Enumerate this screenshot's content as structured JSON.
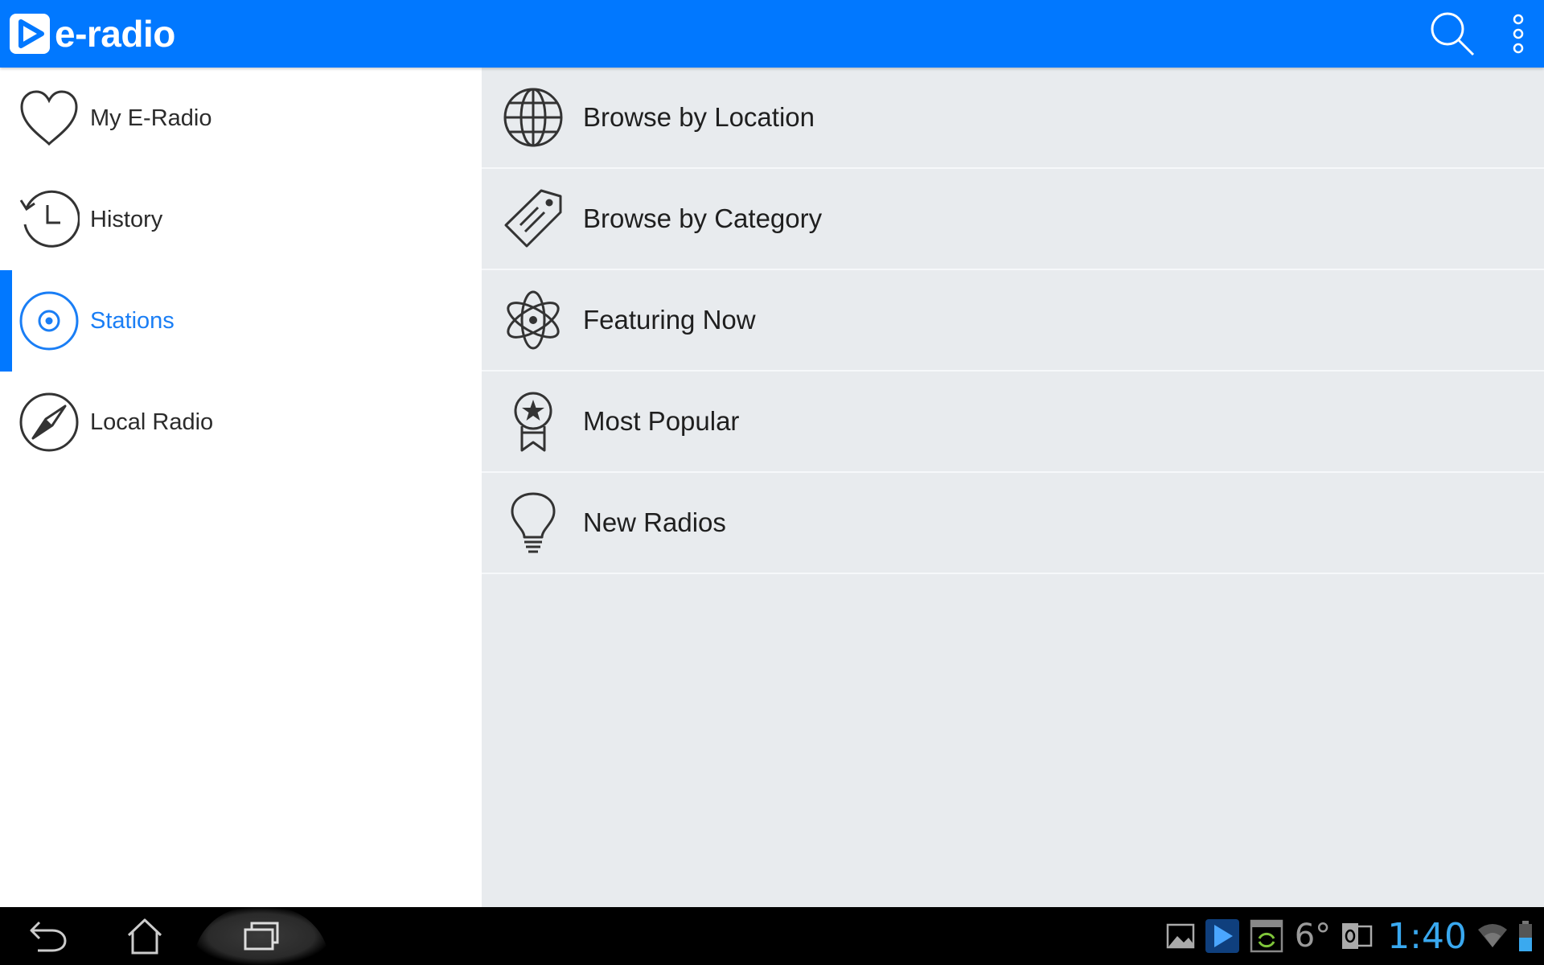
{
  "app": {
    "brand": "e-radio",
    "accent_color": "#0178ff",
    "actions": [
      {
        "icon": "search-icon"
      },
      {
        "icon": "overflow-menu-icon"
      }
    ]
  },
  "drawer": {
    "items": [
      {
        "label": "My E-Radio",
        "icon": "heart-icon",
        "active": false
      },
      {
        "label": "History",
        "icon": "history-icon",
        "active": false
      },
      {
        "label": "Stations",
        "icon": "stations-target-icon",
        "active": true
      },
      {
        "label": "Local Radio",
        "icon": "compass-icon",
        "active": false
      }
    ]
  },
  "browse": {
    "items": [
      {
        "label": "Browse by Location",
        "icon": "globe-icon"
      },
      {
        "label": "Browse by Category",
        "icon": "tag-icon"
      },
      {
        "label": "Featuring Now",
        "icon": "atom-icon"
      },
      {
        "label": "Most Popular",
        "icon": "award-badge-icon"
      },
      {
        "label": "New Radios",
        "icon": "lightbulb-icon"
      }
    ]
  },
  "system_bar": {
    "nav": [
      {
        "icon": "back-icon"
      },
      {
        "icon": "home-icon"
      },
      {
        "icon": "recent-apps-icon"
      }
    ],
    "temperature": "6°",
    "clock": "1:40",
    "status_icons": [
      "gallery-notification-icon",
      "e-radio-notification-icon",
      "download-notification-icon",
      "outlook-notification-icon",
      "wifi-icon",
      "battery-icon"
    ]
  }
}
